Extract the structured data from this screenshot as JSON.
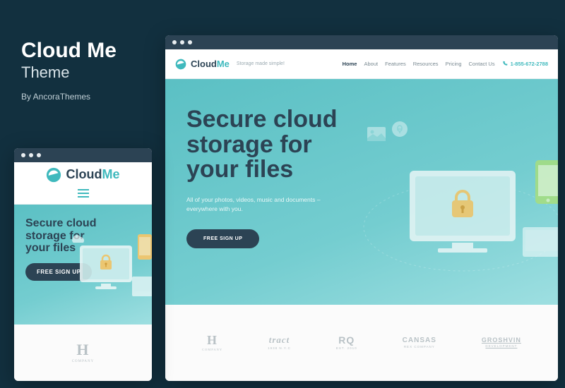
{
  "header": {
    "title": "Cloud Me",
    "subtitle": "Theme",
    "byline": "By AncoraThemes"
  },
  "brand": {
    "name_part1": "Cloud",
    "name_part2": "Me",
    "tagline": "Storage made simple!"
  },
  "nav": {
    "items": [
      {
        "label": "Home",
        "active": true
      },
      {
        "label": "About",
        "active": false
      },
      {
        "label": "Features",
        "active": false
      },
      {
        "label": "Resources",
        "active": false
      },
      {
        "label": "Pricing",
        "active": false
      },
      {
        "label": "Contact Us",
        "active": false
      }
    ],
    "phone": "1-855-672-2788"
  },
  "hero": {
    "title": "Secure cloud storage for your files",
    "subtitle": "All of your photos, videos, music and documents – everywhere with you.",
    "cta": "FREE SIGN UP"
  },
  "logos": [
    {
      "main": "H",
      "sub": "COMPANY"
    },
    {
      "main": "tract",
      "sub": "1938 N.Y.C"
    },
    {
      "main": "RQ",
      "sub": "EST. 2010"
    },
    {
      "main": "CANSAS",
      "sub": "REX COMPANY"
    },
    {
      "main": "GROSHVIN",
      "sub": "DEVELOPMENT"
    }
  ],
  "mobile_logo": {
    "main": "H",
    "sub": "COMPANY"
  }
}
